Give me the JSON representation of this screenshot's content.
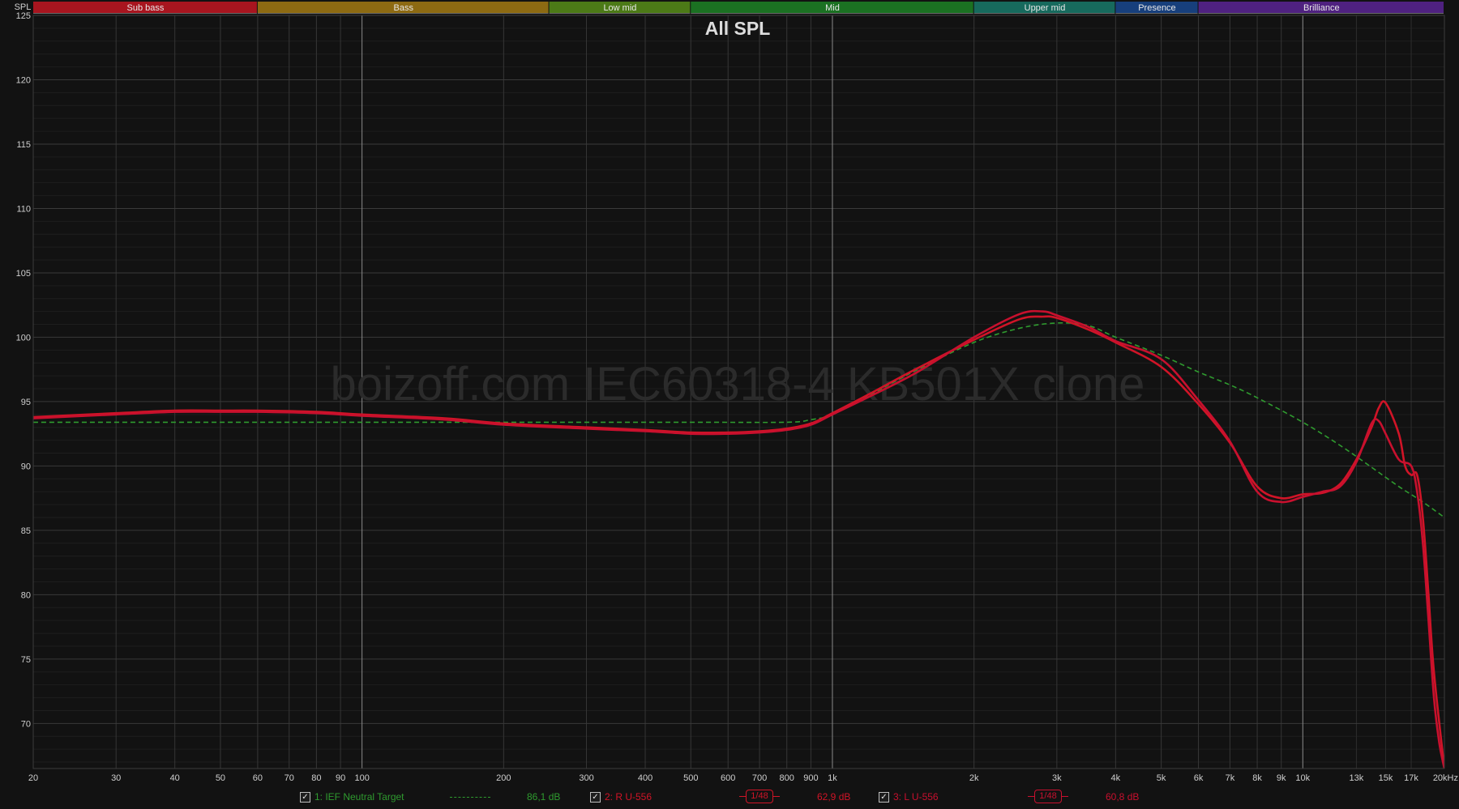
{
  "chart_data": {
    "type": "line",
    "title": "All SPL",
    "ylabel": "SPL",
    "xlabel": "",
    "x_scale": "log",
    "xlim": [
      20,
      20000
    ],
    "ylim": [
      66.5,
      125
    ],
    "grid": true,
    "watermark": "boizoff.com IEC60318-4 KB501X clone",
    "y_ticks": [
      "125",
      "120",
      "115",
      "110",
      "105",
      "100",
      "95",
      "90",
      "85",
      "80",
      "75",
      "70"
    ],
    "y_tick_values": [
      125,
      120,
      115,
      110,
      105,
      100,
      95,
      90,
      85,
      80,
      75,
      70
    ],
    "x_ticks": [
      {
        "f": 20,
        "label": "20"
      },
      {
        "f": 30,
        "label": "30"
      },
      {
        "f": 40,
        "label": "40"
      },
      {
        "f": 50,
        "label": "50"
      },
      {
        "f": 60,
        "label": "60"
      },
      {
        "f": 70,
        "label": "70"
      },
      {
        "f": 80,
        "label": "80"
      },
      {
        "f": 90,
        "label": "90"
      },
      {
        "f": 100,
        "label": "100"
      },
      {
        "f": 200,
        "label": "200"
      },
      {
        "f": 300,
        "label": "300"
      },
      {
        "f": 400,
        "label": "400"
      },
      {
        "f": 500,
        "label": "500"
      },
      {
        "f": 600,
        "label": "600"
      },
      {
        "f": 700,
        "label": "700"
      },
      {
        "f": 800,
        "label": "800"
      },
      {
        "f": 900,
        "label": "900"
      },
      {
        "f": 1000,
        "label": "1k"
      },
      {
        "f": 2000,
        "label": "2k"
      },
      {
        "f": 3000,
        "label": "3k"
      },
      {
        "f": 4000,
        "label": "4k"
      },
      {
        "f": 5000,
        "label": "5k"
      },
      {
        "f": 6000,
        "label": "6k"
      },
      {
        "f": 7000,
        "label": "7k"
      },
      {
        "f": 8000,
        "label": "8k"
      },
      {
        "f": 9000,
        "label": "9k"
      },
      {
        "f": 10000,
        "label": "10k"
      },
      {
        "f": 13000,
        "label": "13k"
      },
      {
        "f": 15000,
        "label": "15k"
      },
      {
        "f": 17000,
        "label": "17k"
      },
      {
        "f": 20000,
        "label": "20kHz"
      }
    ],
    "bands": [
      {
        "label": "Sub bass",
        "from": 20,
        "to": 60,
        "color": "#a8151f"
      },
      {
        "label": "Bass",
        "from": 60,
        "to": 250,
        "color": "#8d6a12"
      },
      {
        "label": "Low mid",
        "from": 250,
        "to": 500,
        "color": "#4c7a17"
      },
      {
        "label": "Mid",
        "from": 500,
        "to": 2000,
        "color": "#1b7122"
      },
      {
        "label": "Upper mid",
        "from": 2000,
        "to": 4000,
        "color": "#176a5d"
      },
      {
        "label": "Presence",
        "from": 4000,
        "to": 6000,
        "color": "#173f7c"
      },
      {
        "label": "Brilliance",
        "from": 6000,
        "to": 20000,
        "color": "#4f2180"
      }
    ],
    "series": [
      {
        "name": "1: IEF Neutral Target",
        "color": "#2f9b2f",
        "dashed": true,
        "level": "86,1 dB",
        "points": [
          [
            20,
            93.4
          ],
          [
            100,
            93.4
          ],
          [
            200,
            93.4
          ],
          [
            500,
            93.4
          ],
          [
            800,
            93.4
          ],
          [
            900,
            93.6
          ],
          [
            1000,
            94.0
          ],
          [
            1200,
            95.5
          ],
          [
            1500,
            97.4
          ],
          [
            2000,
            99.6
          ],
          [
            2500,
            100.7
          ],
          [
            3000,
            101.1
          ],
          [
            3500,
            100.9
          ],
          [
            4000,
            100.0
          ],
          [
            5000,
            98.6
          ],
          [
            6000,
            97.3
          ],
          [
            7000,
            96.3
          ],
          [
            8000,
            95.3
          ],
          [
            10000,
            93.4
          ],
          [
            12000,
            91.6
          ],
          [
            14000,
            89.9
          ],
          [
            16000,
            88.4
          ],
          [
            18000,
            87.2
          ],
          [
            20000,
            86.0
          ]
        ]
      },
      {
        "name": "2: R U-556",
        "color": "#d01427",
        "dashed": false,
        "smoothing": "1/48",
        "level": "62,9 dB",
        "points": [
          [
            20,
            93.8
          ],
          [
            30,
            94.1
          ],
          [
            40,
            94.3
          ],
          [
            50,
            94.3
          ],
          [
            60,
            94.3
          ],
          [
            80,
            94.2
          ],
          [
            100,
            94.0
          ],
          [
            150,
            93.7
          ],
          [
            200,
            93.3
          ],
          [
            300,
            93.0
          ],
          [
            400,
            92.8
          ],
          [
            500,
            92.6
          ],
          [
            600,
            92.6
          ],
          [
            700,
            92.7
          ],
          [
            800,
            92.9
          ],
          [
            900,
            93.3
          ],
          [
            1000,
            94.1
          ],
          [
            1200,
            95.6
          ],
          [
            1500,
            97.5
          ],
          [
            2000,
            99.8
          ],
          [
            2500,
            101.4
          ],
          [
            2800,
            101.6
          ],
          [
            3000,
            101.5
          ],
          [
            3500,
            100.6
          ],
          [
            4000,
            99.6
          ],
          [
            5000,
            97.7
          ],
          [
            6000,
            94.8
          ],
          [
            7000,
            91.8
          ],
          [
            8000,
            88.4
          ],
          [
            9000,
            87.5
          ],
          [
            10000,
            87.8
          ],
          [
            11000,
            87.9
          ],
          [
            12000,
            88.6
          ],
          [
            13000,
            90.5
          ],
          [
            14000,
            93.0
          ],
          [
            14500,
            94.5
          ],
          [
            15000,
            94.9
          ],
          [
            16000,
            92.5
          ],
          [
            16500,
            90.0
          ],
          [
            17000,
            89.3
          ],
          [
            17500,
            89.3
          ],
          [
            18000,
            86.0
          ],
          [
            18500,
            80.0
          ],
          [
            19000,
            74.0
          ],
          [
            20000,
            66.5
          ]
        ]
      },
      {
        "name": "3: L U-556",
        "color": "#c8102e",
        "dashed": false,
        "smoothing": "1/48",
        "level": "60,8 dB",
        "points": [
          [
            20,
            93.7
          ],
          [
            30,
            94.0
          ],
          [
            40,
            94.2
          ],
          [
            50,
            94.2
          ],
          [
            60,
            94.2
          ],
          [
            80,
            94.1
          ],
          [
            100,
            93.9
          ],
          [
            150,
            93.6
          ],
          [
            200,
            93.2
          ],
          [
            300,
            92.9
          ],
          [
            400,
            92.7
          ],
          [
            500,
            92.5
          ],
          [
            600,
            92.5
          ],
          [
            700,
            92.6
          ],
          [
            800,
            92.8
          ],
          [
            900,
            93.2
          ],
          [
            1000,
            94.0
          ],
          [
            1200,
            95.4
          ],
          [
            1500,
            97.2
          ],
          [
            2000,
            100.0
          ],
          [
            2500,
            101.8
          ],
          [
            2800,
            102.0
          ],
          [
            3000,
            101.7
          ],
          [
            3500,
            100.8
          ],
          [
            4000,
            99.7
          ],
          [
            5000,
            98.3
          ],
          [
            6000,
            95.1
          ],
          [
            7000,
            91.9
          ],
          [
            8000,
            88.0
          ],
          [
            9000,
            87.2
          ],
          [
            10000,
            87.6
          ],
          [
            11000,
            88.0
          ],
          [
            12000,
            88.4
          ],
          [
            13000,
            90.3
          ],
          [
            14000,
            93.3
          ],
          [
            14500,
            93.5
          ],
          [
            15000,
            92.5
          ],
          [
            16000,
            90.5
          ],
          [
            17000,
            90.0
          ],
          [
            17500,
            88.0
          ],
          [
            18000,
            84.0
          ],
          [
            18500,
            78.0
          ],
          [
            19000,
            72.0
          ],
          [
            19500,
            68.5
          ],
          [
            20000,
            66.5
          ]
        ]
      }
    ]
  }
}
